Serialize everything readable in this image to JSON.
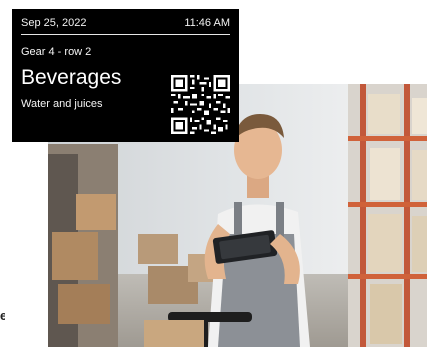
{
  "label": {
    "date": "Sep 25, 2022",
    "time": "11:46 AM",
    "location": "Gear 4 - row 2",
    "category": "Beverages",
    "description": "Water and juices",
    "code_icon": "qr-code-icon"
  },
  "photo": {
    "subject_icon": "warehouse-worker-photo"
  },
  "edge": {
    "text": "e"
  },
  "colors": {
    "panel_bg": "#000000",
    "panel_text": "#ffffff",
    "shelf_orange": "#d0623a",
    "overalls": "#8c9096"
  }
}
